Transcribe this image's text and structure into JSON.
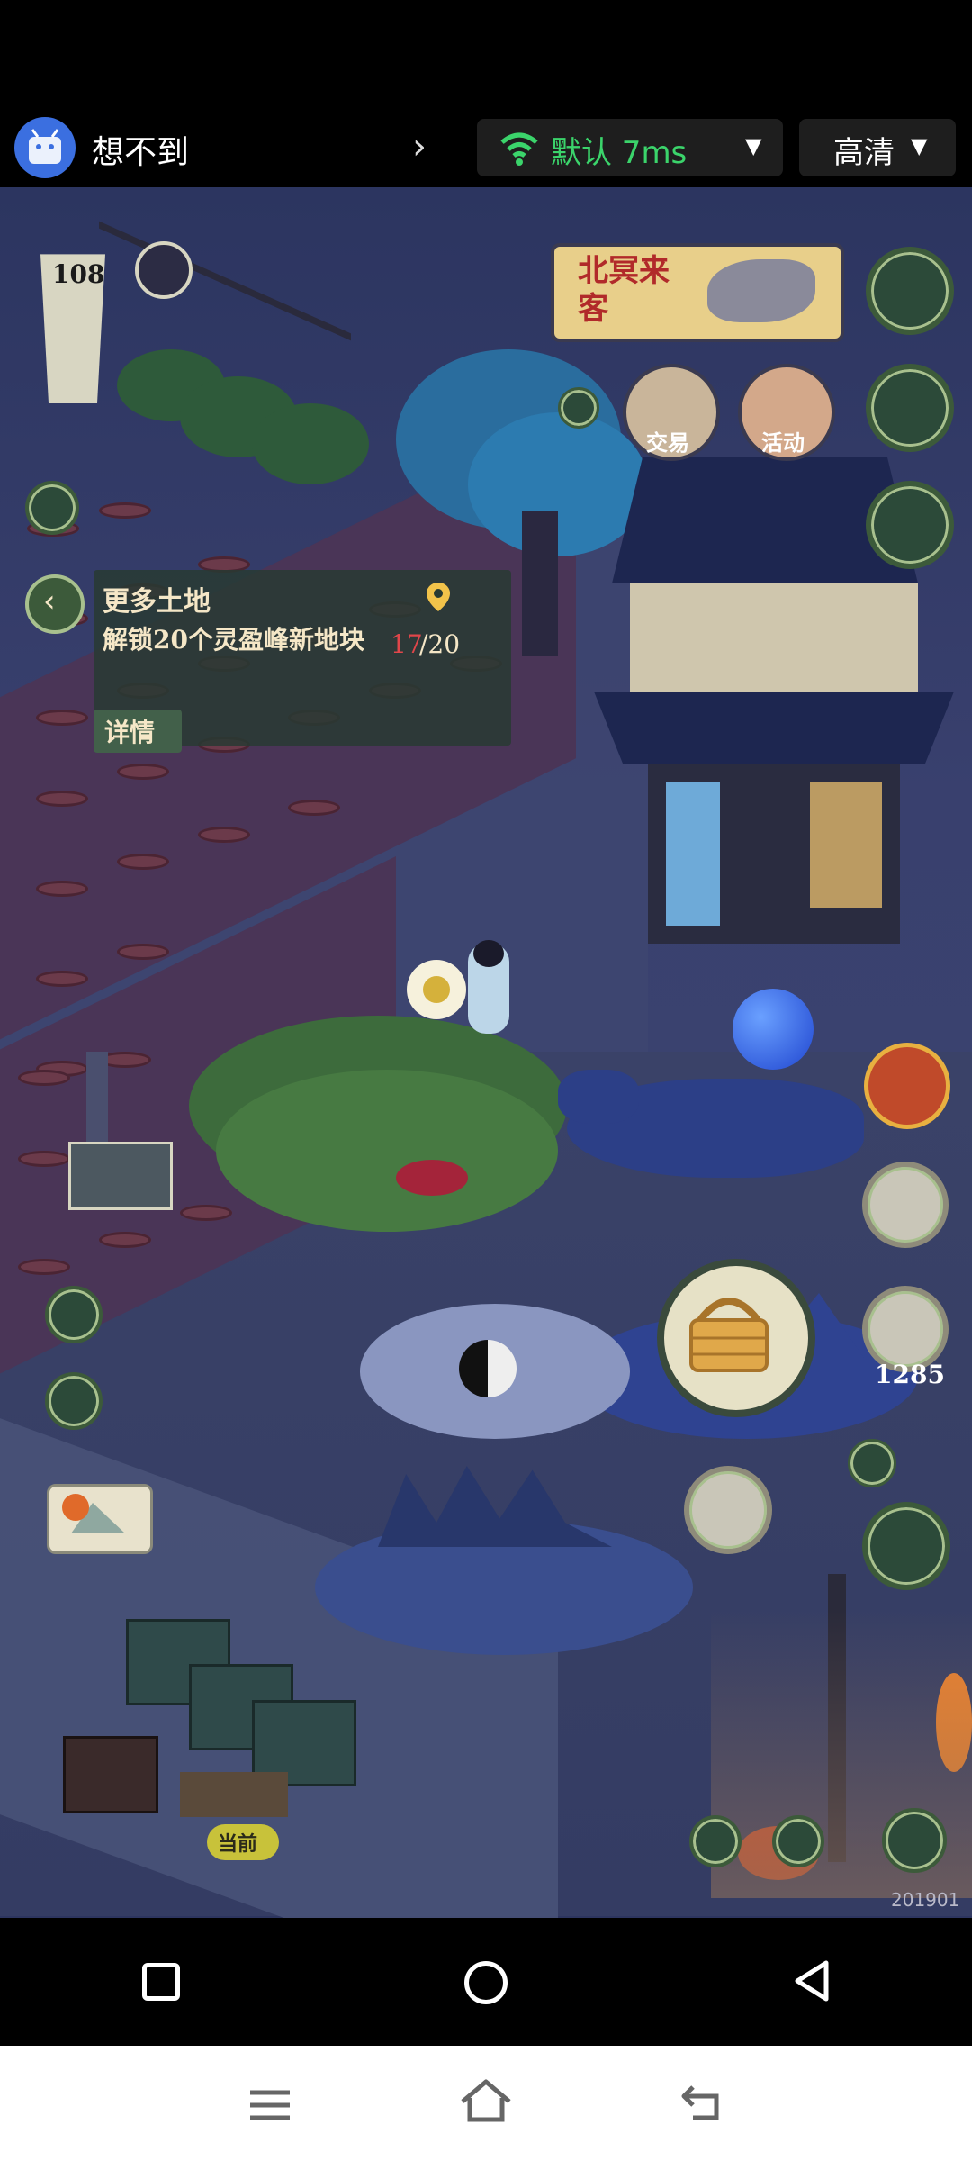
{
  "app": {
    "title": "想不到",
    "network_label": "默认 7ms",
    "quality_label": "高清"
  },
  "game": {
    "level": "108",
    "event_banner": "北冥来客",
    "buttons": {
      "trade": "交易",
      "activity": "活动"
    },
    "quest": {
      "title": "更多土地",
      "description": "解锁20个灵盈峰新地块",
      "progress_current": "17",
      "progress_total": "/20",
      "detail_label": "详情"
    },
    "currency_count": "1285",
    "current_marker": "当前",
    "watermark": "201901"
  },
  "colors": {
    "accent_green": "#3bd46b",
    "panel_bg": "#283a32",
    "progress_red": "#e0464a"
  },
  "icons": {
    "app_icon": "android-icon",
    "wifi": "wifi-icon",
    "nav": [
      "square-icon",
      "circle-icon",
      "back-triangle-icon"
    ],
    "nav2": [
      "menu-icon",
      "home-icon",
      "return-icon"
    ]
  }
}
